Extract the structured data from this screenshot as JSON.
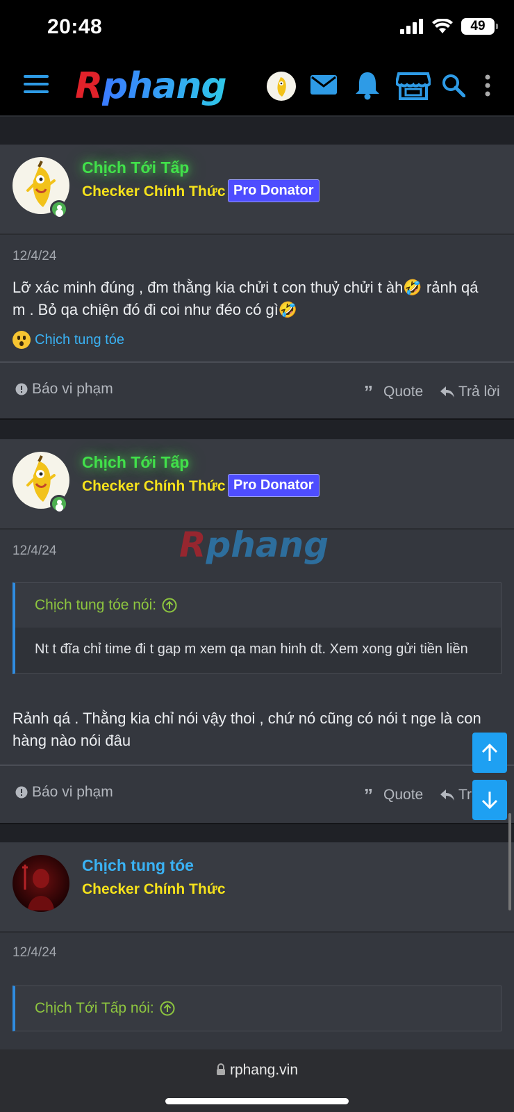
{
  "status_bar": {
    "time": "20:48",
    "battery": "49"
  },
  "header": {
    "logo_r": "R",
    "logo_rest": "phang",
    "icons": [
      "menu-icon",
      "avatar",
      "mail-icon",
      "bell-icon",
      "store-icon",
      "search-icon",
      "more-icon"
    ]
  },
  "posts": [
    {
      "username": "Chịch Tới Tấp",
      "title": "Checker Chính Thức",
      "badge": "Pro Donator",
      "date": "12/4/24",
      "text": "Lỡ xác minh đúng , đm thằng kia chửi t con thuỷ chửi t àh🤣 rảnh qá m . Bỏ qa chiện đó đi coi như đéo có gì🤣",
      "reaction_user": "Chịch tung tóe",
      "report": "Báo vi phạm",
      "quote": "Quote",
      "reply": "Trả lời"
    },
    {
      "username": "Chịch Tới Tấp",
      "title": "Checker Chính Thức",
      "badge": "Pro Donator",
      "date": "12/4/24",
      "quote_author": "Chịch tung tóe nói:",
      "quote_text": "Nt t đĩa chỉ time đi t gap m xem qa man hinh dt. Xem xong gửi tiền liền",
      "text": "Rảnh qá . Thằng kia chỉ nói vậy thoi , chứ nó cũng có nói t nge là con hàng nào nói đâu",
      "report": "Báo vi phạm",
      "quote": "Quote",
      "reply": "Trả lời"
    },
    {
      "username": "Chịch tung tóe",
      "title": "Checker Chính Thức",
      "date": "12/4/24",
      "quote_author": "Chịch Tới Tấp nói:"
    }
  ],
  "watermark": {
    "r": "R",
    "rest": "phang"
  },
  "browser": {
    "url": "rphang.vin"
  },
  "colors": {
    "accent": "#1ea0f2",
    "username_green": "#41e14a",
    "username_blue": "#3ab2f4",
    "title_yellow": "#f6e21b",
    "badge_bg": "#4e4dff",
    "quote_author": "#8ec63f"
  }
}
